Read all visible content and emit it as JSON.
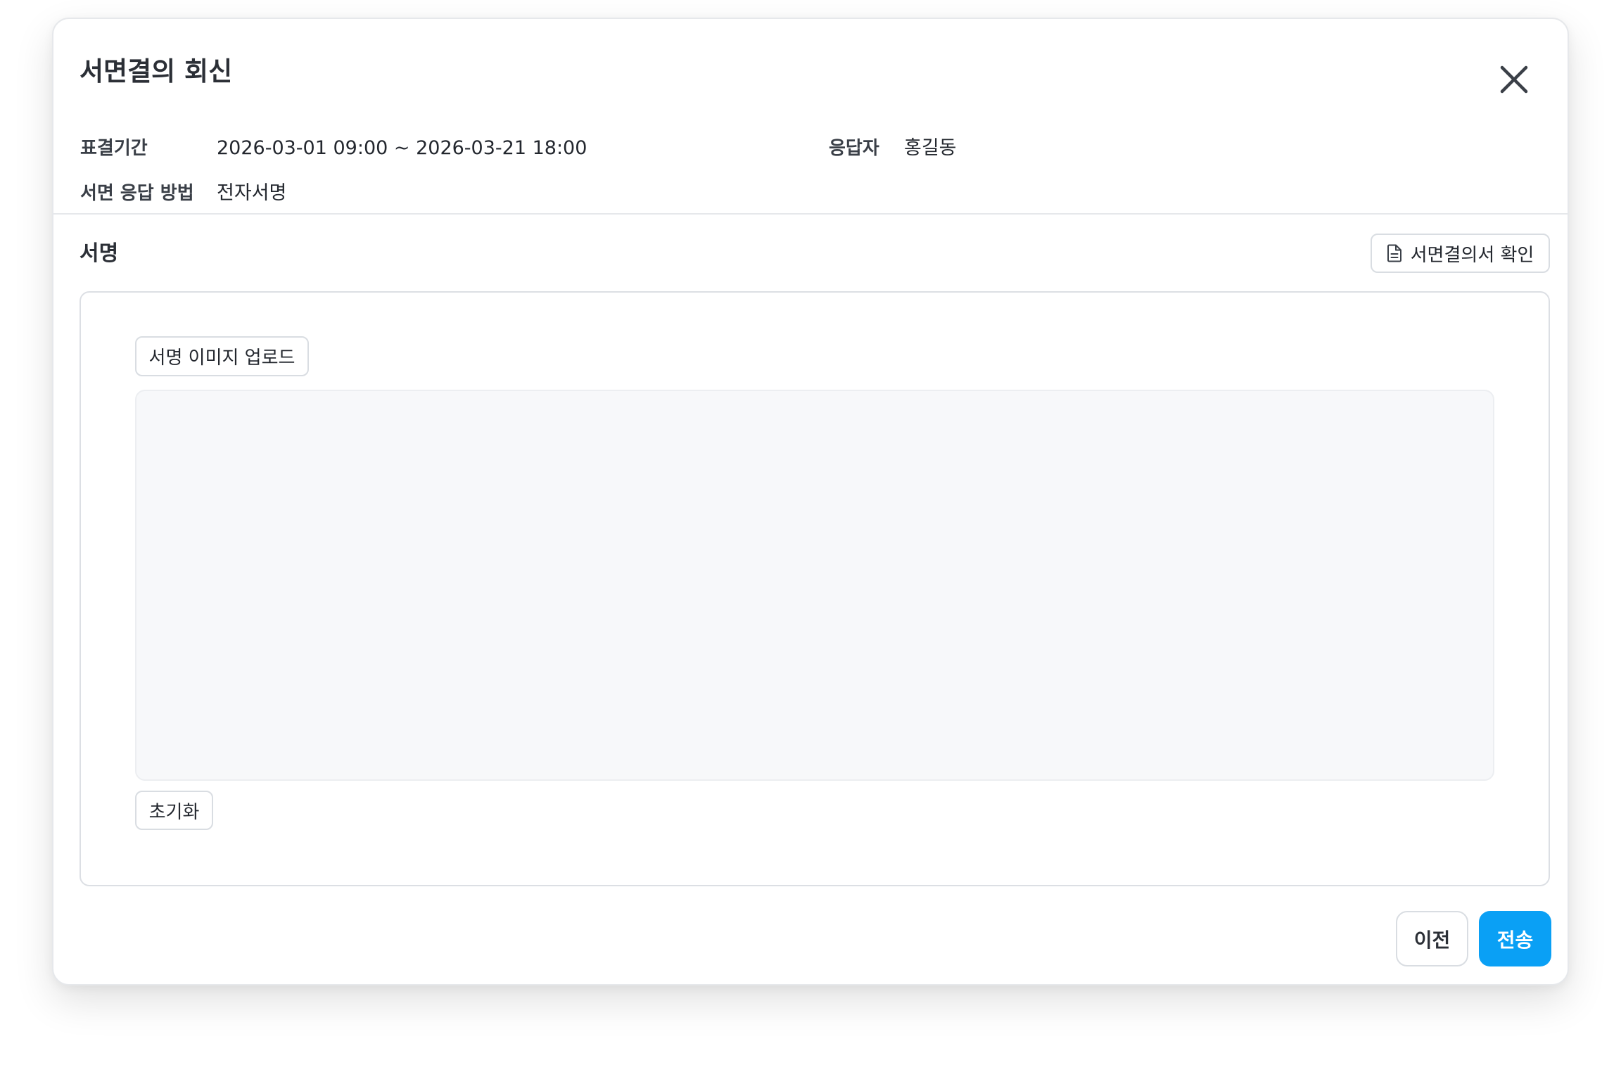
{
  "dialog": {
    "title": "서면결의 회신"
  },
  "info": {
    "period_label": "표결기간",
    "period_value": "2026-03-01 09:00 ~ 2026-03-21 18:00",
    "respondent_label": "응답자",
    "respondent_value": "홍길동",
    "method_label": "서면 응답 방법",
    "method_value": "전자서명"
  },
  "signature": {
    "section_title": "서명",
    "view_document_label": "서면결의서 확인",
    "view_document_icon": "document-icon",
    "upload_label": "서명 이미지 업로드",
    "reset_label": "초기화"
  },
  "footer": {
    "prev_label": "이전",
    "send_label": "전송"
  },
  "icons": {
    "close": "close-icon"
  },
  "colors": {
    "primary": "#0aa0f5",
    "canvas_bg": "#f7f8fa",
    "border": "#e6e8eb"
  }
}
